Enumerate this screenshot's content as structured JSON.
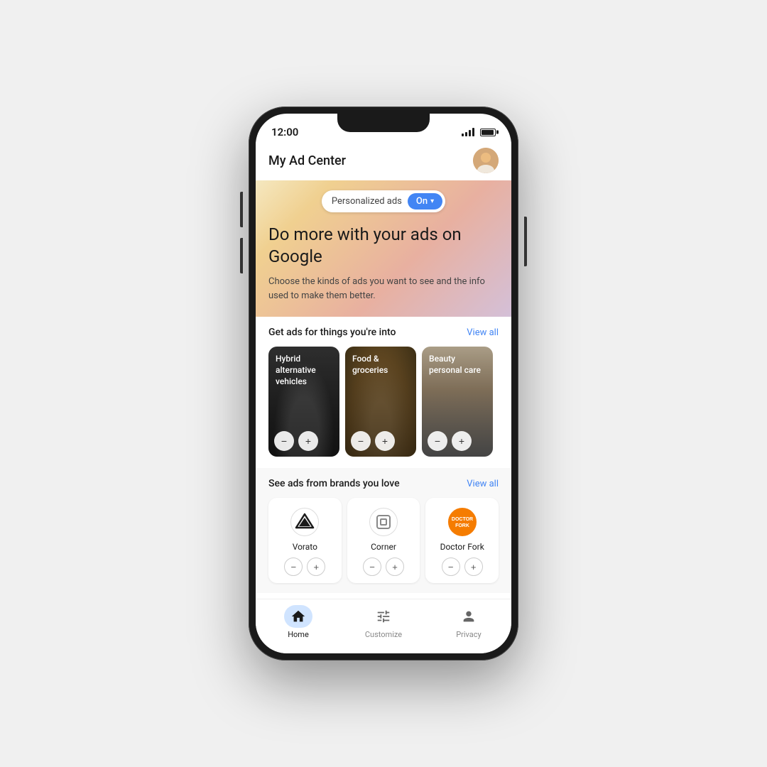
{
  "phone": {
    "status": {
      "time": "12:00"
    }
  },
  "header": {
    "title": "My Ad Center"
  },
  "toggle": {
    "label": "Personalized ads",
    "state": "On"
  },
  "hero": {
    "heading": "Do more with your ads on Google",
    "subtext": "Choose the kinds of ads you want to see and the info used to make them better."
  },
  "interests_section": {
    "title": "Get ads for things you're into",
    "view_all": "View all",
    "cards": [
      {
        "label": "Hybrid alternative vehicles"
      },
      {
        "label": "Food & groceries"
      },
      {
        "label": "Beauty personal care"
      }
    ]
  },
  "brands_section": {
    "title": "See ads from brands you love",
    "view_all": "View all",
    "brands": [
      {
        "name": "Vorato"
      },
      {
        "name": "Corner"
      },
      {
        "name": "Doctor Fork"
      }
    ]
  },
  "bottom_nav": {
    "items": [
      {
        "label": "Home",
        "active": true
      },
      {
        "label": "Customize",
        "active": false
      },
      {
        "label": "Privacy",
        "active": false
      }
    ]
  },
  "buttons": {
    "minus": "−",
    "plus": "+"
  }
}
